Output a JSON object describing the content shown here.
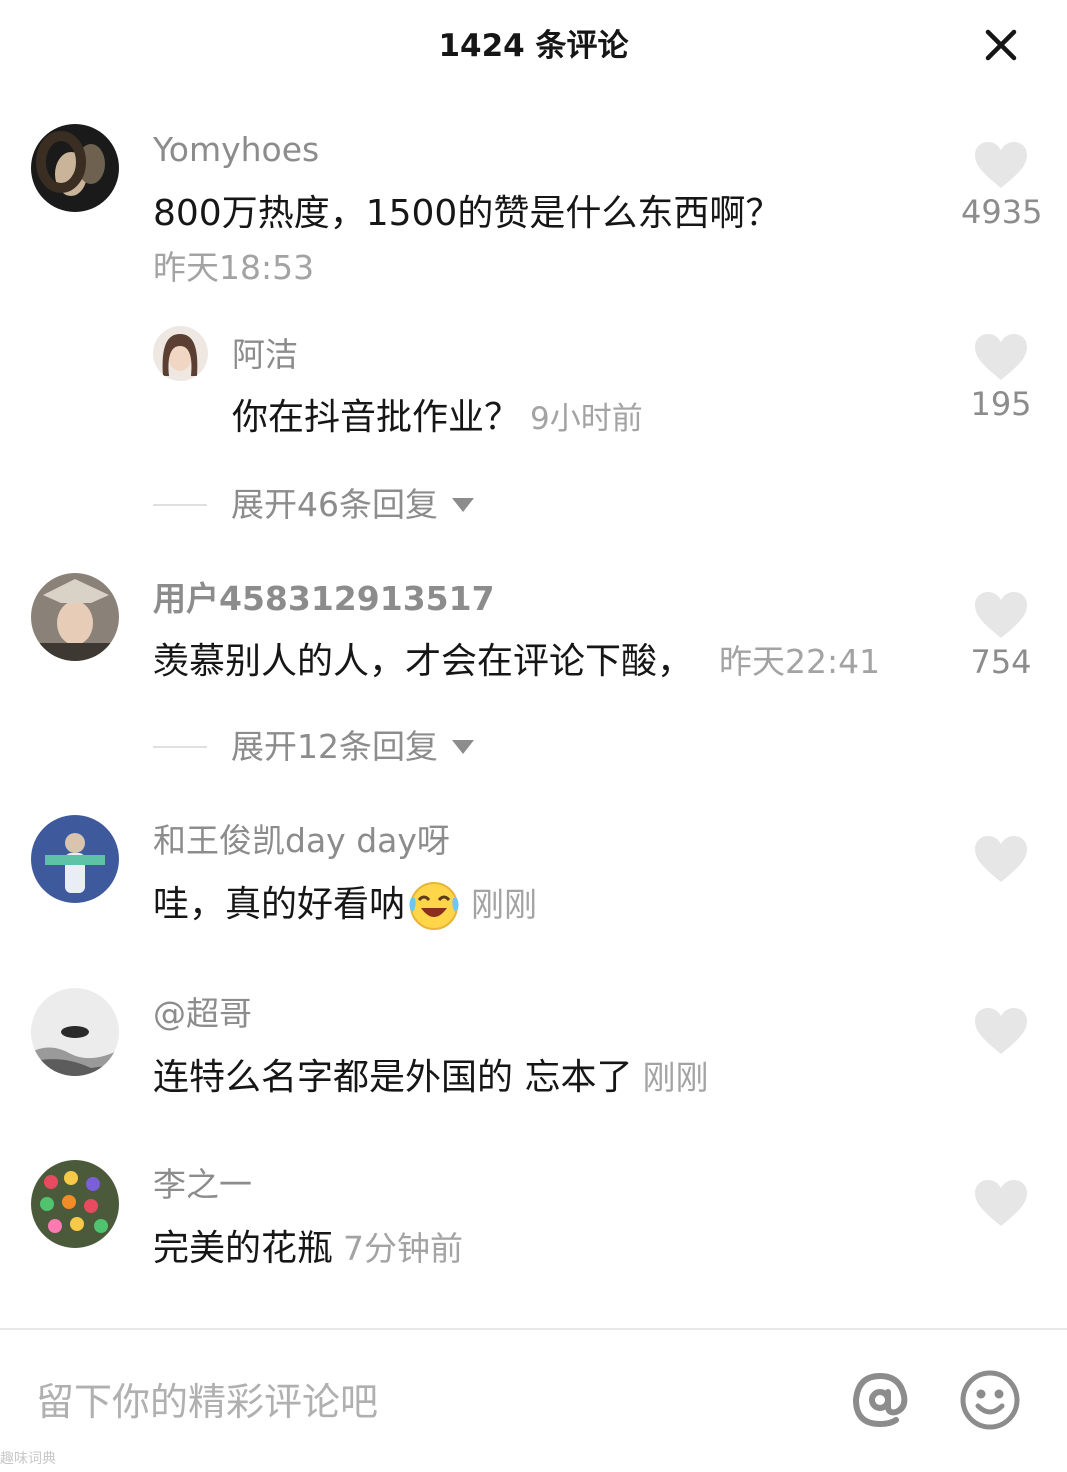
{
  "header": {
    "title": "1424 条评论"
  },
  "comments": [
    {
      "user": "Yomyhoes",
      "text": "800万热度，1500的赞是什么东西啊？",
      "time": "昨天18:53",
      "likes": "4935",
      "reply": {
        "user": "阿洁",
        "text": "你在抖音批作业？",
        "time": "9小时前",
        "likes": "195"
      },
      "expand": "展开46条回复"
    },
    {
      "user": "用户458312913517",
      "text": "羡慕别人的人，才会在评论下酸，",
      "time": "昨天22:41",
      "likes": "754",
      "expand": "展开12条回复"
    },
    {
      "user": "和王俊凯day day呀",
      "text": "哇，真的好看呐",
      "time": "刚刚",
      "emoji": "laugh-cry"
    },
    {
      "user": "@超哥",
      "text": "连特么名字都是外国的 忘本了",
      "time": "刚刚"
    },
    {
      "user": "李之一",
      "text": "完美的花瓶",
      "time": "7分钟前"
    }
  ],
  "footer": {
    "placeholder": "留下你的精彩评论吧",
    "icons": [
      "at-icon",
      "smiley-icon"
    ]
  },
  "watermark": "趣味词典",
  "colors": {
    "text": "#161616",
    "secondary": "#8c8c8c",
    "heart": "#e6e6e6",
    "divider": "#e8e8e8"
  }
}
